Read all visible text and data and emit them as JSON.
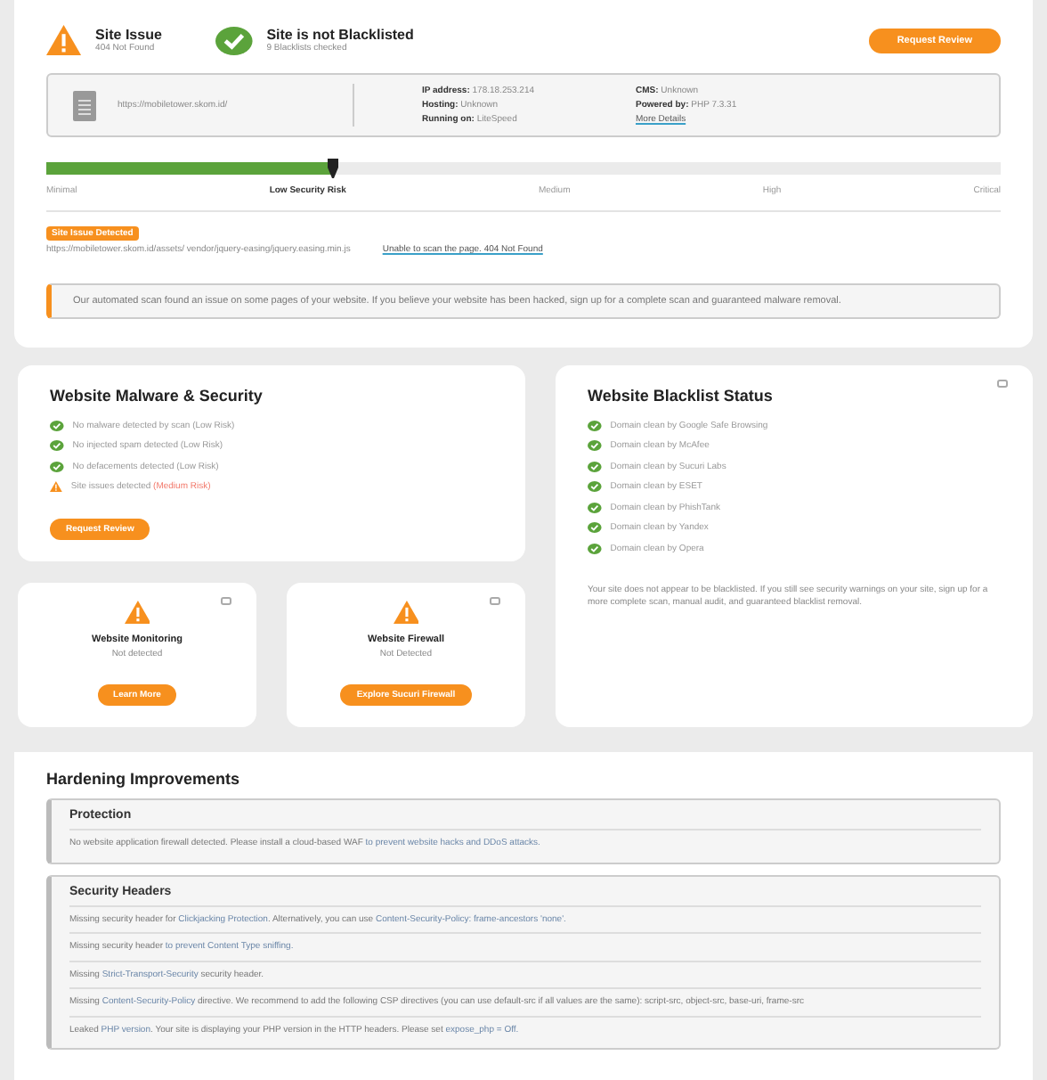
{
  "header": {
    "issue": {
      "title": "Site Issue",
      "subtitle": "404 Not Found"
    },
    "blacklist": {
      "title": "Site is not Blacklisted",
      "subtitle": "9 Blacklists checked"
    },
    "button": "Request Review"
  },
  "site_info": {
    "url": "https://mobiletower.skom.id/",
    "columns": [
      [
        {
          "kind": "field",
          "label": "IP address:",
          "value": "178.18.253.214"
        },
        {
          "kind": "field",
          "label": "Hosting:",
          "value": "Unknown"
        },
        {
          "kind": "field",
          "label": "Running on:",
          "value": "LiteSpeed"
        }
      ],
      [
        {
          "kind": "field",
          "label": "CMS:",
          "value": "Unknown"
        },
        {
          "kind": "field",
          "label": "Powered by:",
          "value": "PHP 7.3.31"
        },
        {
          "kind": "link",
          "label": "More Details"
        }
      ]
    ]
  },
  "risk": {
    "level": 0.3,
    "labels": [
      {
        "text": "Minimal",
        "selected": false
      },
      {
        "text": "Low Security Risk",
        "selected": true
      },
      {
        "text": "Medium",
        "selected": false
      },
      {
        "text": "High",
        "selected": false
      },
      {
        "text": "Critical",
        "selected": false
      }
    ]
  },
  "issue": {
    "badge": "Site Issue Detected",
    "url": "https://mobiletower.skom.id/assets/ vendor/jquery-easing/jquery.easing.min.js",
    "link": "Unable to scan the page. 404 Not Found"
  },
  "notice": "Our automated scan found an issue on some pages of your website. If you believe your website has been hacked, sign up for a complete scan and guaranteed malware removal.",
  "malware": {
    "title": "Website Malware & Security",
    "items": [
      {
        "kind": "ok",
        "text": "No malware detected by scan",
        "risk": "(Low Risk)"
      },
      {
        "kind": "ok",
        "text": "No injected spam detected",
        "risk": "(Low Risk)"
      },
      {
        "kind": "ok",
        "text": "No defacements detected",
        "risk": "(Low Risk)"
      },
      {
        "kind": "warn",
        "text": "Site issues detected",
        "risk": "(Medium Risk)"
      }
    ],
    "button": "Request Review"
  },
  "small_cards": [
    {
      "title": "Website Monitoring",
      "status": "Not detected",
      "button": "Learn More"
    },
    {
      "title": "Website Firewall",
      "status": "Not Detected",
      "button": "Explore Sucuri Firewall"
    }
  ],
  "blacklist": {
    "title": "Website Blacklist Status",
    "items": [
      "Domain clean by Google Safe Browsing",
      "Domain clean by McAfee",
      "Domain clean by Sucuri Labs",
      "Domain clean by ESET",
      "Domain clean by PhishTank",
      "Domain clean by Yandex",
      "Domain clean by Opera"
    ],
    "note": "Your site does not appear to be blacklisted. If you still see security warnings on your site, sign up for a more complete scan, manual audit, and guaranteed blacklist removal."
  },
  "hardening": {
    "title": "Hardening Improvements",
    "sections": [
      {
        "title": "Protection",
        "lines": [
          [
            {
              "text": "No website application firewall detected. Please install a cloud-based WAF ",
              "link": false
            },
            {
              "text": "to prevent website hacks and DDoS attacks.",
              "link": true
            }
          ]
        ]
      },
      {
        "title": "Security Headers",
        "lines": [
          [
            {
              "text": "Missing security header for ",
              "link": false
            },
            {
              "text": "Clickjacking Protection",
              "link": true
            },
            {
              "text": ". Alternatively, you can use ",
              "link": false
            },
            {
              "text": "Content-Security-Policy: frame-ancestors 'none'.",
              "link": true
            }
          ],
          [
            {
              "text": "Missing security header ",
              "link": false
            },
            {
              "text": "to prevent Content Type sniffing.",
              "link": true
            }
          ],
          [
            {
              "text": "Missing ",
              "link": false
            },
            {
              "text": "Strict-Transport-Security",
              "link": true
            },
            {
              "text": " security header.",
              "link": false
            }
          ],
          [
            {
              "text": "Missing ",
              "link": false
            },
            {
              "text": "Content-Security-Policy",
              "link": true
            },
            {
              "text": " directive. We recommend to add the following CSP directives (you can use default-src if all values are the same): script-src, object-src, base-uri, frame-src",
              "link": false
            }
          ],
          [
            {
              "text": "Leaked ",
              "link": false
            },
            {
              "text": "PHP version",
              "link": true
            },
            {
              "text": ". Your site is displaying your PHP version in the HTTP headers. Please set ",
              "link": false
            },
            {
              "text": "expose_php = Off.",
              "link": true
            }
          ]
        ]
      }
    ]
  }
}
